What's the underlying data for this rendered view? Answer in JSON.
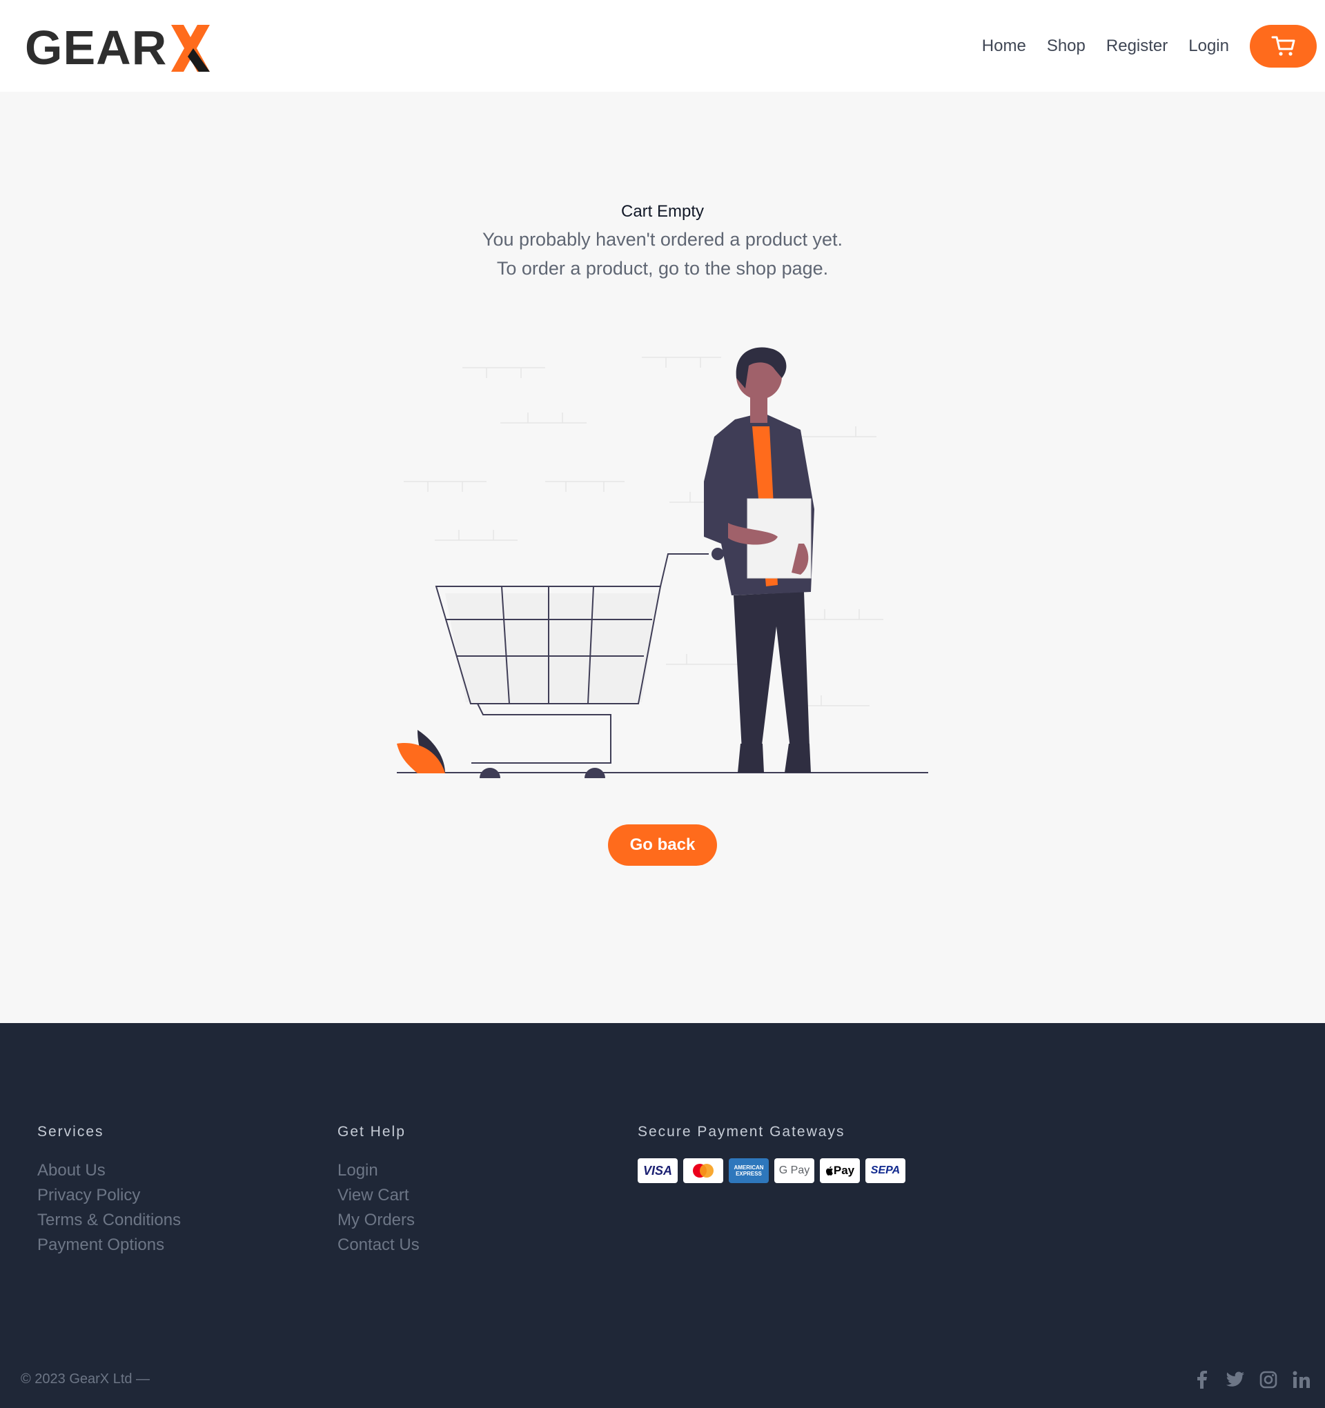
{
  "brand": {
    "name_part1": "GEAR",
    "name_part2": "X",
    "accent_color": "#ff6b1c"
  },
  "nav": {
    "items": [
      "Home",
      "Shop",
      "Register",
      "Login"
    ],
    "cart_icon": "shopping-cart-icon"
  },
  "empty_state": {
    "title": "Cart Empty",
    "line1": "You probably haven't ordered a product yet.",
    "line2": "To order a product, go to the shop page.",
    "button": "Go back"
  },
  "footer": {
    "services": {
      "title": "Services",
      "links": [
        "About Us",
        "Privacy Policy",
        "Terms & Conditions",
        "Payment Options"
      ]
    },
    "help": {
      "title": "Get Help",
      "links": [
        "Login",
        "View Cart",
        "My Orders",
        "Contact Us"
      ]
    },
    "payments": {
      "title": "Secure Payment Gateways",
      "methods": [
        "VISA",
        "Mastercard",
        "AMERICAN EXPRESS",
        "G Pay",
        "Pay",
        "SEPA"
      ]
    },
    "copyright": "© 2023 GearX Ltd —",
    "social": [
      "facebook-icon",
      "twitter-icon",
      "instagram-icon",
      "linkedin-icon"
    ]
  },
  "colors": {
    "footer_bg": "#1f2737",
    "page_bg": "#f7f7f7",
    "accent": "#ff6b1c"
  }
}
